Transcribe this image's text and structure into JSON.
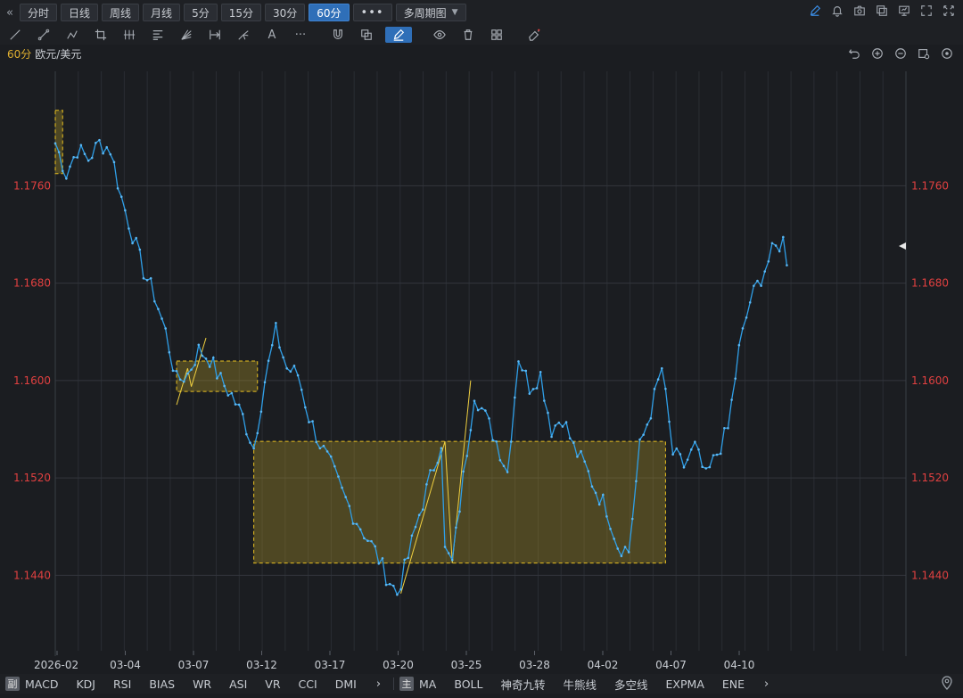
{
  "toolbar": {
    "collapse": "«",
    "timeframes": [
      "分时",
      "日线",
      "周线",
      "月线",
      "5分",
      "15分",
      "30分",
      "60分"
    ],
    "active_timeframe": "60分",
    "more": "•••",
    "multi_period": "多周期图",
    "right_icons": [
      "edit-icon",
      "bell-icon",
      "camera-icon",
      "copy-icon",
      "monitor-icon",
      "expand-icon",
      "fullscreen-icon"
    ]
  },
  "drawing_tools": [
    "line-tool-icon",
    "ray-tool-icon",
    "polyline-tool-icon",
    "crop-tool-icon",
    "parallel-tool-icon",
    "fib-tool-icon",
    "fan-tool-icon",
    "range-tool-icon",
    "pitchfork-tool-icon",
    "text-tool-icon",
    "more-tool-icon",
    "magnet-icon",
    "layers-icon",
    "pen-icon",
    "eye-icon",
    "trash-icon",
    "grid-icon",
    "eraser-icon"
  ],
  "drawing_text_label": "A",
  "drawing_more_label": "···",
  "symbol": {
    "period": "60分",
    "name": "欧元/美元"
  },
  "chart_controls": [
    "undo-icon",
    "zoom-in-icon",
    "zoom-out-icon",
    "settings-icon",
    "target-icon"
  ],
  "chart_data": {
    "type": "line",
    "y_ticks": [
      "1.1760",
      "1.1680",
      "1.1600",
      "1.1520",
      "1.1440"
    ],
    "y_tick_values": [
      1.176,
      1.168,
      1.16,
      1.152,
      1.144
    ],
    "ylim": [
      1.1378,
      1.1854
    ],
    "x_labels": [
      "2026-02",
      "03-04",
      "03-07",
      "03-12",
      "03-17",
      "03-20",
      "03-25",
      "03-28",
      "04-02",
      "04-07",
      "04-10"
    ],
    "n_points": 200,
    "line_color": "#2f9fe8",
    "box_color": "#e8c020",
    "anchors": [
      [
        0,
        1.1795
      ],
      [
        3,
        1.177
      ],
      [
        6,
        1.179
      ],
      [
        9,
        1.1782
      ],
      [
        12,
        1.1795
      ],
      [
        15,
        1.179
      ],
      [
        18,
        1.175
      ],
      [
        21,
        1.172
      ],
      [
        24,
        1.169
      ],
      [
        27,
        1.167
      ],
      [
        30,
        1.164
      ],
      [
        33,
        1.16
      ],
      [
        36,
        1.1605
      ],
      [
        39,
        1.1625
      ],
      [
        42,
        1.1618
      ],
      [
        45,
        1.16
      ],
      [
        48,
        1.1588
      ],
      [
        51,
        1.157
      ],
      [
        54,
        1.1545
      ],
      [
        57,
        1.16
      ],
      [
        60,
        1.164
      ],
      [
        63,
        1.161
      ],
      [
        66,
        1.1605
      ],
      [
        69,
        1.157
      ],
      [
        72,
        1.1548
      ],
      [
        75,
        1.153
      ],
      [
        78,
        1.1508
      ],
      [
        81,
        1.149
      ],
      [
        84,
        1.1475
      ],
      [
        87,
        1.146
      ],
      [
        90,
        1.144
      ],
      [
        93,
        1.1425
      ],
      [
        96,
        1.1455
      ],
      [
        99,
        1.149
      ],
      [
        102,
        1.152
      ],
      [
        105,
        1.155
      ],
      [
        106,
        1.146
      ],
      [
        108,
        1.145
      ],
      [
        111,
        1.152
      ],
      [
        114,
        1.159
      ],
      [
        117,
        1.157
      ],
      [
        120,
        1.155
      ],
      [
        123,
        1.1525
      ],
      [
        126,
        1.162
      ],
      [
        129,
        1.1595
      ],
      [
        132,
        1.1605
      ],
      [
        135,
        1.156
      ],
      [
        138,
        1.157
      ],
      [
        141,
        1.1545
      ],
      [
        144,
        1.153
      ],
      [
        147,
        1.151
      ],
      [
        150,
        1.1495
      ],
      [
        153,
        1.1465
      ],
      [
        156,
        1.146
      ],
      [
        159,
        1.1545
      ],
      [
        162,
        1.1575
      ],
      [
        165,
        1.161
      ],
      [
        168,
        1.154
      ],
      [
        171,
        1.153
      ],
      [
        174,
        1.1545
      ],
      [
        177,
        1.152
      ],
      [
        180,
        1.154
      ],
      [
        183,
        1.156
      ],
      [
        186,
        1.1625
      ],
      [
        189,
        1.1665
      ],
      [
        192,
        1.1685
      ],
      [
        195,
        1.1705
      ],
      [
        198,
        1.1715
      ],
      [
        199,
        1.17
      ]
    ],
    "boxes": [
      {
        "x0": 0,
        "x1": 2,
        "y0": 1.177,
        "y1": 1.1822
      },
      {
        "x0": 33,
        "x1": 55,
        "y0": 1.1591,
        "y1": 1.1616
      },
      {
        "x0": 54,
        "x1": 166,
        "y0": 1.145,
        "y1": 1.155
      }
    ],
    "zigzags": [
      [
        [
          33,
          1.158
        ],
        [
          36,
          1.161
        ],
        [
          37,
          1.1595
        ],
        [
          41,
          1.1635
        ]
      ],
      [
        [
          94,
          1.1425
        ],
        [
          106,
          1.155
        ],
        [
          108,
          1.145
        ],
        [
          113,
          1.16
        ]
      ]
    ],
    "last_price_marker": true
  },
  "indicators": {
    "sub_label": "副",
    "sub_items": [
      "MACD",
      "KDJ",
      "RSI",
      "BIAS",
      "WR",
      "ASI",
      "VR",
      "CCI",
      "DMI"
    ],
    "sub_more": "›",
    "main_label": "主",
    "main_items": [
      "MA",
      "BOLL",
      "神奇九转",
      "牛熊线",
      "多空线",
      "EXPMA",
      "ENE"
    ],
    "main_more": "›"
  },
  "colors": {
    "accent": "#2f6fb8",
    "price_label": "#e04040",
    "line": "#2f9fe8",
    "box": "#e8c020"
  }
}
